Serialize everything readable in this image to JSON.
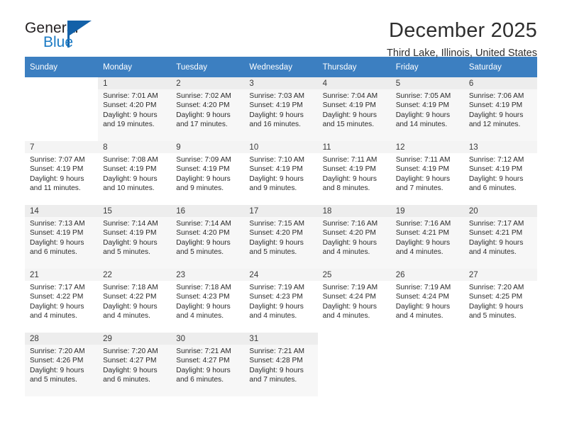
{
  "brand": {
    "name_part1": "General",
    "name_part2": "Blue",
    "logo_icon": "triangle-flag-icon",
    "color_dark": "#231f20",
    "color_blue": "#1a7ac4",
    "color_triangle": "#1361a8"
  },
  "header": {
    "month_year": "December 2025",
    "location": "Third Lake, Illinois, United States",
    "header_bg": "#3c7fc1",
    "header_text_color": "#ffffff"
  },
  "weekday_headers": [
    "Sunday",
    "Monday",
    "Tuesday",
    "Wednesday",
    "Thursday",
    "Friday",
    "Saturday"
  ],
  "labels": {
    "sunrise_prefix": "Sunrise:",
    "sunset_prefix": "Sunset:",
    "daylight_prefix": "Daylight:"
  },
  "weeks": [
    [
      {
        "day": "",
        "blank": true,
        "sunrise": "",
        "sunset": "",
        "daylight_line1": "",
        "daylight_line2": ""
      },
      {
        "day": "1",
        "sunrise": "Sunrise: 7:01 AM",
        "sunset": "Sunset: 4:20 PM",
        "daylight_line1": "Daylight: 9 hours",
        "daylight_line2": "and 19 minutes."
      },
      {
        "day": "2",
        "sunrise": "Sunrise: 7:02 AM",
        "sunset": "Sunset: 4:20 PM",
        "daylight_line1": "Daylight: 9 hours",
        "daylight_line2": "and 17 minutes."
      },
      {
        "day": "3",
        "sunrise": "Sunrise: 7:03 AM",
        "sunset": "Sunset: 4:19 PM",
        "daylight_line1": "Daylight: 9 hours",
        "daylight_line2": "and 16 minutes."
      },
      {
        "day": "4",
        "sunrise": "Sunrise: 7:04 AM",
        "sunset": "Sunset: 4:19 PM",
        "daylight_line1": "Daylight: 9 hours",
        "daylight_line2": "and 15 minutes."
      },
      {
        "day": "5",
        "sunrise": "Sunrise: 7:05 AM",
        "sunset": "Sunset: 4:19 PM",
        "daylight_line1": "Daylight: 9 hours",
        "daylight_line2": "and 14 minutes."
      },
      {
        "day": "6",
        "sunrise": "Sunrise: 7:06 AM",
        "sunset": "Sunset: 4:19 PM",
        "daylight_line1": "Daylight: 9 hours",
        "daylight_line2": "and 12 minutes."
      }
    ],
    [
      {
        "day": "7",
        "sunrise": "Sunrise: 7:07 AM",
        "sunset": "Sunset: 4:19 PM",
        "daylight_line1": "Daylight: 9 hours",
        "daylight_line2": "and 11 minutes."
      },
      {
        "day": "8",
        "sunrise": "Sunrise: 7:08 AM",
        "sunset": "Sunset: 4:19 PM",
        "daylight_line1": "Daylight: 9 hours",
        "daylight_line2": "and 10 minutes."
      },
      {
        "day": "9",
        "sunrise": "Sunrise: 7:09 AM",
        "sunset": "Sunset: 4:19 PM",
        "daylight_line1": "Daylight: 9 hours",
        "daylight_line2": "and 9 minutes."
      },
      {
        "day": "10",
        "sunrise": "Sunrise: 7:10 AM",
        "sunset": "Sunset: 4:19 PM",
        "daylight_line1": "Daylight: 9 hours",
        "daylight_line2": "and 9 minutes."
      },
      {
        "day": "11",
        "sunrise": "Sunrise: 7:11 AM",
        "sunset": "Sunset: 4:19 PM",
        "daylight_line1": "Daylight: 9 hours",
        "daylight_line2": "and 8 minutes."
      },
      {
        "day": "12",
        "sunrise": "Sunrise: 7:11 AM",
        "sunset": "Sunset: 4:19 PM",
        "daylight_line1": "Daylight: 9 hours",
        "daylight_line2": "and 7 minutes."
      },
      {
        "day": "13",
        "sunrise": "Sunrise: 7:12 AM",
        "sunset": "Sunset: 4:19 PM",
        "daylight_line1": "Daylight: 9 hours",
        "daylight_line2": "and 6 minutes."
      }
    ],
    [
      {
        "day": "14",
        "sunrise": "Sunrise: 7:13 AM",
        "sunset": "Sunset: 4:19 PM",
        "daylight_line1": "Daylight: 9 hours",
        "daylight_line2": "and 6 minutes."
      },
      {
        "day": "15",
        "sunrise": "Sunrise: 7:14 AM",
        "sunset": "Sunset: 4:19 PM",
        "daylight_line1": "Daylight: 9 hours",
        "daylight_line2": "and 5 minutes."
      },
      {
        "day": "16",
        "sunrise": "Sunrise: 7:14 AM",
        "sunset": "Sunset: 4:20 PM",
        "daylight_line1": "Daylight: 9 hours",
        "daylight_line2": "and 5 minutes."
      },
      {
        "day": "17",
        "sunrise": "Sunrise: 7:15 AM",
        "sunset": "Sunset: 4:20 PM",
        "daylight_line1": "Daylight: 9 hours",
        "daylight_line2": "and 5 minutes."
      },
      {
        "day": "18",
        "sunrise": "Sunrise: 7:16 AM",
        "sunset": "Sunset: 4:20 PM",
        "daylight_line1": "Daylight: 9 hours",
        "daylight_line2": "and 4 minutes."
      },
      {
        "day": "19",
        "sunrise": "Sunrise: 7:16 AM",
        "sunset": "Sunset: 4:21 PM",
        "daylight_line1": "Daylight: 9 hours",
        "daylight_line2": "and 4 minutes."
      },
      {
        "day": "20",
        "sunrise": "Sunrise: 7:17 AM",
        "sunset": "Sunset: 4:21 PM",
        "daylight_line1": "Daylight: 9 hours",
        "daylight_line2": "and 4 minutes."
      }
    ],
    [
      {
        "day": "21",
        "sunrise": "Sunrise: 7:17 AM",
        "sunset": "Sunset: 4:22 PM",
        "daylight_line1": "Daylight: 9 hours",
        "daylight_line2": "and 4 minutes."
      },
      {
        "day": "22",
        "sunrise": "Sunrise: 7:18 AM",
        "sunset": "Sunset: 4:22 PM",
        "daylight_line1": "Daylight: 9 hours",
        "daylight_line2": "and 4 minutes."
      },
      {
        "day": "23",
        "sunrise": "Sunrise: 7:18 AM",
        "sunset": "Sunset: 4:23 PM",
        "daylight_line1": "Daylight: 9 hours",
        "daylight_line2": "and 4 minutes."
      },
      {
        "day": "24",
        "sunrise": "Sunrise: 7:19 AM",
        "sunset": "Sunset: 4:23 PM",
        "daylight_line1": "Daylight: 9 hours",
        "daylight_line2": "and 4 minutes."
      },
      {
        "day": "25",
        "sunrise": "Sunrise: 7:19 AM",
        "sunset": "Sunset: 4:24 PM",
        "daylight_line1": "Daylight: 9 hours",
        "daylight_line2": "and 4 minutes."
      },
      {
        "day": "26",
        "sunrise": "Sunrise: 7:19 AM",
        "sunset": "Sunset: 4:24 PM",
        "daylight_line1": "Daylight: 9 hours",
        "daylight_line2": "and 4 minutes."
      },
      {
        "day": "27",
        "sunrise": "Sunrise: 7:20 AM",
        "sunset": "Sunset: 4:25 PM",
        "daylight_line1": "Daylight: 9 hours",
        "daylight_line2": "and 5 minutes."
      }
    ],
    [
      {
        "day": "28",
        "sunrise": "Sunrise: 7:20 AM",
        "sunset": "Sunset: 4:26 PM",
        "daylight_line1": "Daylight: 9 hours",
        "daylight_line2": "and 5 minutes."
      },
      {
        "day": "29",
        "sunrise": "Sunrise: 7:20 AM",
        "sunset": "Sunset: 4:27 PM",
        "daylight_line1": "Daylight: 9 hours",
        "daylight_line2": "and 6 minutes."
      },
      {
        "day": "30",
        "sunrise": "Sunrise: 7:21 AM",
        "sunset": "Sunset: 4:27 PM",
        "daylight_line1": "Daylight: 9 hours",
        "daylight_line2": "and 6 minutes."
      },
      {
        "day": "31",
        "sunrise": "Sunrise: 7:21 AM",
        "sunset": "Sunset: 4:28 PM",
        "daylight_line1": "Daylight: 9 hours",
        "daylight_line2": "and 7 minutes."
      },
      {
        "day": "",
        "blank": true,
        "sunrise": "",
        "sunset": "",
        "daylight_line1": "",
        "daylight_line2": ""
      },
      {
        "day": "",
        "blank": true,
        "sunrise": "",
        "sunset": "",
        "daylight_line1": "",
        "daylight_line2": ""
      },
      {
        "day": "",
        "blank": true,
        "sunrise": "",
        "sunset": "",
        "daylight_line1": "",
        "daylight_line2": ""
      }
    ]
  ]
}
